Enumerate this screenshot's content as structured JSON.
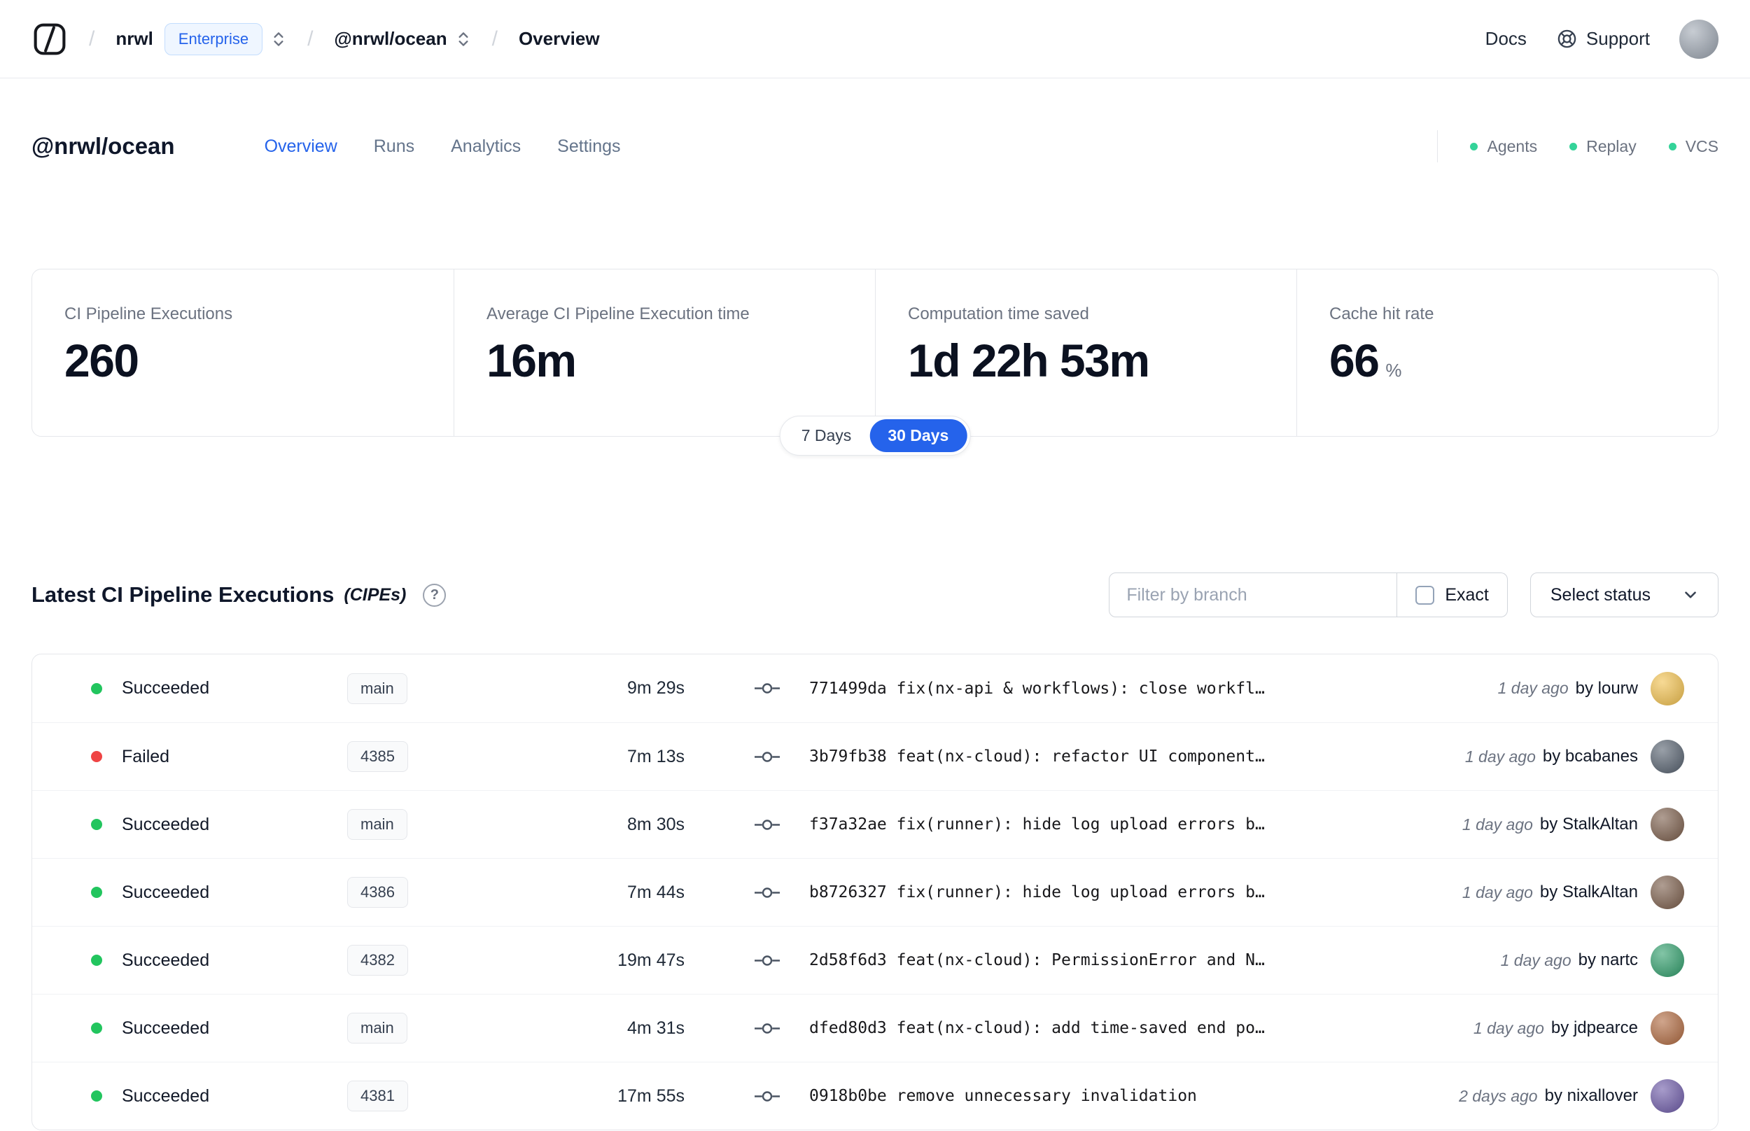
{
  "colors": {
    "accent": "#2563eb",
    "success": "#22c55e",
    "danger": "#ef4444",
    "avatar_top": "#9aa3af"
  },
  "navbar": {
    "org": "nrwl",
    "org_badge": "Enterprise",
    "workspace": "@nrwl/ocean",
    "page": "Overview",
    "docs_label": "Docs",
    "support_label": "Support"
  },
  "header": {
    "title": "@nrwl/ocean",
    "tabs": [
      {
        "label": "Overview"
      },
      {
        "label": "Runs"
      },
      {
        "label": "Analytics"
      },
      {
        "label": "Settings"
      }
    ],
    "statuses": [
      {
        "label": "Agents",
        "dot_color": "#34d399"
      },
      {
        "label": "Replay",
        "dot_color": "#34d399"
      },
      {
        "label": "VCS",
        "dot_color": "#34d399"
      }
    ]
  },
  "metrics": {
    "cards": [
      {
        "label": "CI Pipeline Executions",
        "value": "260",
        "suffix": ""
      },
      {
        "label": "Average CI Pipeline Execution time",
        "value": "16m",
        "suffix": ""
      },
      {
        "label": "Computation time saved",
        "value": "1d 22h 53m",
        "suffix": ""
      },
      {
        "label": "Cache hit rate",
        "value": "66",
        "suffix": "%"
      }
    ],
    "range": {
      "options": [
        {
          "label": "7 Days"
        },
        {
          "label": "30 Days"
        }
      ],
      "selected": "30 Days"
    }
  },
  "cipes": {
    "title": "Latest CI Pipeline Executions",
    "title_suffix": "(CIPEs)",
    "filter_placeholder": "Filter by branch",
    "exact_label": "Exact",
    "status_select_label": "Select status",
    "rows": [
      {
        "status": "Succeeded",
        "dot_color": "#22c55e",
        "branch": "main",
        "duration": "9m 29s",
        "commit": "771499da fix(nx-api & workflows): close workfl…",
        "time": "1 day ago",
        "author": "by lourw",
        "avatar_color": "#f2c14e"
      },
      {
        "status": "Failed",
        "dot_color": "#ef4444",
        "branch": "4385",
        "duration": "7m 13s",
        "commit": "3b79fb38 feat(nx-cloud): refactor UI component…",
        "time": "1 day ago",
        "author": "by bcabanes",
        "avatar_color": "#55606e"
      },
      {
        "status": "Succeeded",
        "dot_color": "#22c55e",
        "branch": "main",
        "duration": "8m 30s",
        "commit": "f37a32ae fix(runner): hide log upload errors b…",
        "time": "1 day ago",
        "author": "by StalkAltan",
        "avatar_color": "#7a5c49"
      },
      {
        "status": "Succeeded",
        "dot_color": "#22c55e",
        "branch": "4386",
        "duration": "7m 44s",
        "commit": "b8726327 fix(runner): hide log upload errors b…",
        "time": "1 day ago",
        "author": "by StalkAltan",
        "avatar_color": "#7a5c49"
      },
      {
        "status": "Succeeded",
        "dot_color": "#22c55e",
        "branch": "4382",
        "duration": "19m 47s",
        "commit": "2d58f6d3 feat(nx-cloud): PermissionError and N…",
        "time": "1 day ago",
        "author": "by nartc",
        "avatar_color": "#2f9e6b"
      },
      {
        "status": "Succeeded",
        "dot_color": "#22c55e",
        "branch": "main",
        "duration": "4m 31s",
        "commit": "dfed80d3 feat(nx-cloud): add time-saved end po…",
        "time": "1 day ago",
        "author": "by jdpearce",
        "avatar_color": "#b0693f"
      },
      {
        "status": "Succeeded",
        "dot_color": "#22c55e",
        "branch": "4381",
        "duration": "17m 55s",
        "commit": "0918b0be remove unnecessary invalidation",
        "time": "2 days ago",
        "author": "by nixallover",
        "avatar_color": "#6d5aa8"
      }
    ]
  }
}
